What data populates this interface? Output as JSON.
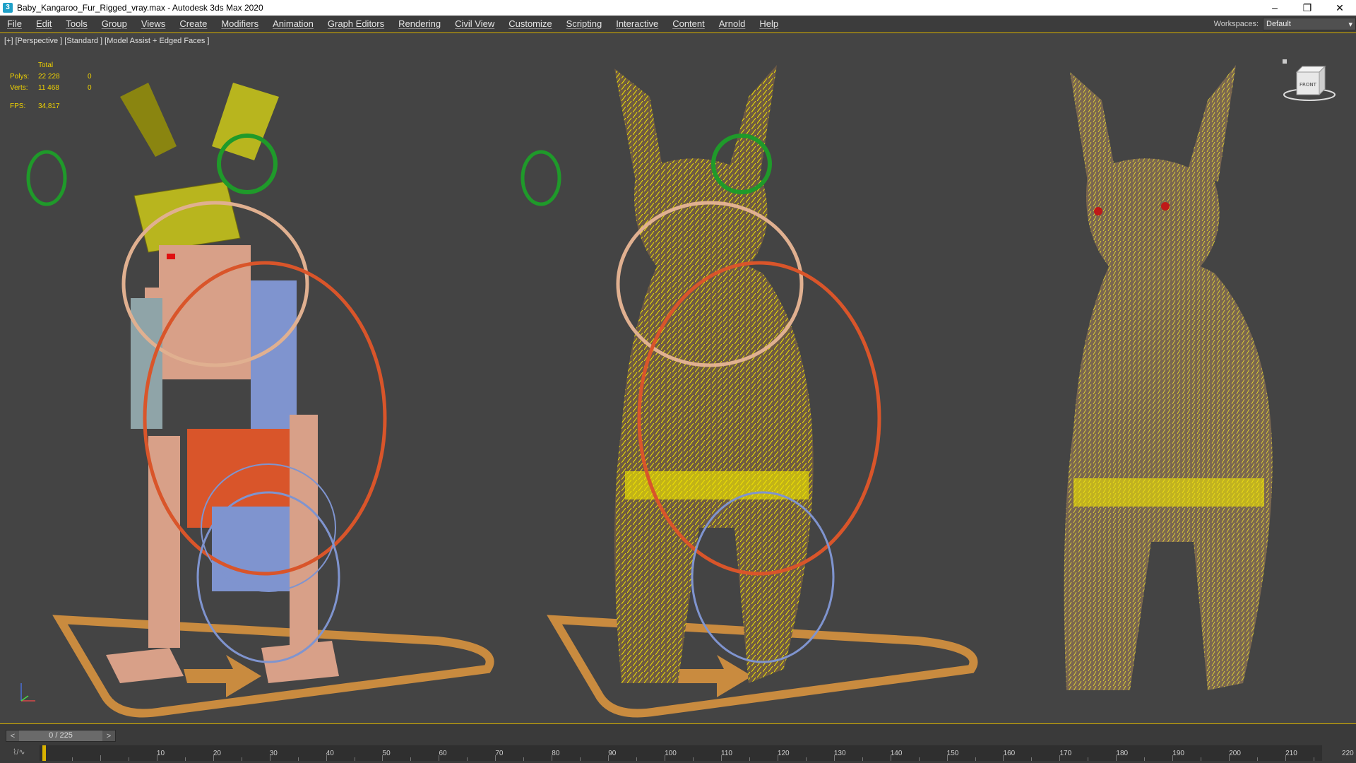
{
  "window": {
    "title": "Baby_Kangaroo_Fur_Rigged_vray.max - Autodesk 3ds Max 2020",
    "minimize": "–",
    "restore": "❐",
    "close": "✕"
  },
  "menu": [
    "File",
    "Edit",
    "Tools",
    "Group",
    "Views",
    "Create",
    "Modifiers",
    "Animation",
    "Graph Editors",
    "Rendering",
    "Civil View",
    "Customize",
    "Scripting",
    "Interactive",
    "Content",
    "Arnold",
    "Help"
  ],
  "workspace": {
    "label": "Workspaces:",
    "value": "Default"
  },
  "viewport": {
    "label": "[+] [Perspective ] [Standard ] [Model Assist + Edged Faces ]",
    "stats": {
      "header": "Total",
      "polys_label": "Polys:",
      "polys_total": "22 228",
      "polys_sel": "0",
      "verts_label": "Verts:",
      "verts_total": "11 468",
      "verts_sel": "0",
      "fps_label": "FPS:",
      "fps_value": "34,817"
    },
    "viewcube_label": "FRONT"
  },
  "timeline": {
    "slider_text": "0 / 225",
    "prev": "<",
    "next": ">",
    "frames": [
      "10",
      "20",
      "30",
      "40",
      "50",
      "60",
      "70",
      "80",
      "90",
      "100",
      "110",
      "120",
      "130",
      "140",
      "150",
      "160",
      "170",
      "180",
      "190",
      "200",
      "210",
      "220"
    ],
    "current_frame": 0,
    "total_frames": 225
  },
  "colors": {
    "accent": "#d9b200",
    "bone_yellow": "#c8be1e",
    "bone_skin": "#d8a088",
    "bone_blue": "#7f94cf",
    "bone_orange": "#d9552a",
    "control_green": "#1f9a2a",
    "fur_yellow": "#f0e400",
    "base_wood": "#c98b3f"
  }
}
